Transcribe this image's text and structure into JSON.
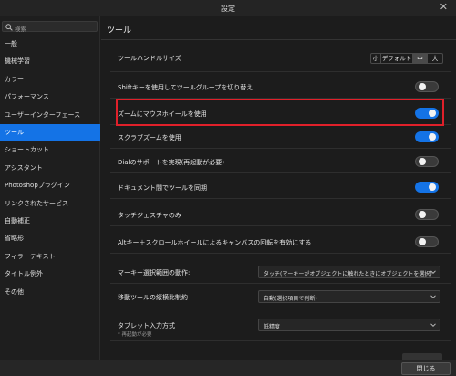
{
  "window": {
    "title": "設定",
    "close_glyph": "✕"
  },
  "search": {
    "placeholder": "検索"
  },
  "sidebar": {
    "items": [
      {
        "label": "一般",
        "active": false
      },
      {
        "label": "機械学習",
        "active": false
      },
      {
        "label": "カラー",
        "active": false
      },
      {
        "label": "パフォーマンス",
        "active": false
      },
      {
        "label": "ユーザーインターフェース",
        "active": false
      },
      {
        "label": "ツール",
        "active": true
      },
      {
        "label": "ショートカット",
        "active": false
      },
      {
        "label": "アシスタント",
        "active": false
      },
      {
        "label": "Photoshopプラグイン",
        "active": false
      },
      {
        "label": "リンクされたサービス",
        "active": false
      },
      {
        "label": "自動補正",
        "active": false
      },
      {
        "label": "省略形",
        "active": false
      },
      {
        "label": "フィラーテキスト",
        "active": false
      },
      {
        "label": "タイトル例外",
        "active": false
      },
      {
        "label": "その他",
        "active": false
      }
    ]
  },
  "main": {
    "title": "ツール",
    "handle_size": {
      "label": "ツールハンドルサイズ",
      "options": [
        "小",
        "デフォルト",
        "中",
        "大"
      ],
      "selected": "中"
    },
    "toggles": [
      {
        "label": "Shiftキーを使用してツールグループを切り替え",
        "on": false
      },
      {
        "label": "ズームにマウスホイールを使用",
        "on": true,
        "highlighted": true
      },
      {
        "label": "スクラブズームを使用",
        "on": true
      },
      {
        "label": "Dialのサポートを実現(再起動が必要)",
        "on": false
      },
      {
        "label": "ドキュメント間でツールを同期",
        "on": true
      },
      {
        "label": "タッチジェスチャのみ",
        "on": false
      },
      {
        "label": "Altキー＋スクロールホイールによるキャンバスの回転を有効にする",
        "on": false
      }
    ],
    "dropdowns": [
      {
        "label": "マーキー選択範囲の動作:",
        "value": "タッチ(マーキーがオブジェクトに触れたときにオブジェクトを選択)"
      },
      {
        "label": "移動ツールの縦横比制約",
        "value": "自動(選択項目で判断)"
      },
      {
        "label": "タブレット入力方式",
        "sublabel": "* 再起動が必要",
        "value": "低精度"
      }
    ]
  },
  "footer": {
    "close_label": "閉じる"
  },
  "colors": {
    "accent": "#1473e6",
    "highlight": "#e0202a",
    "background": "#1c1c1c"
  }
}
